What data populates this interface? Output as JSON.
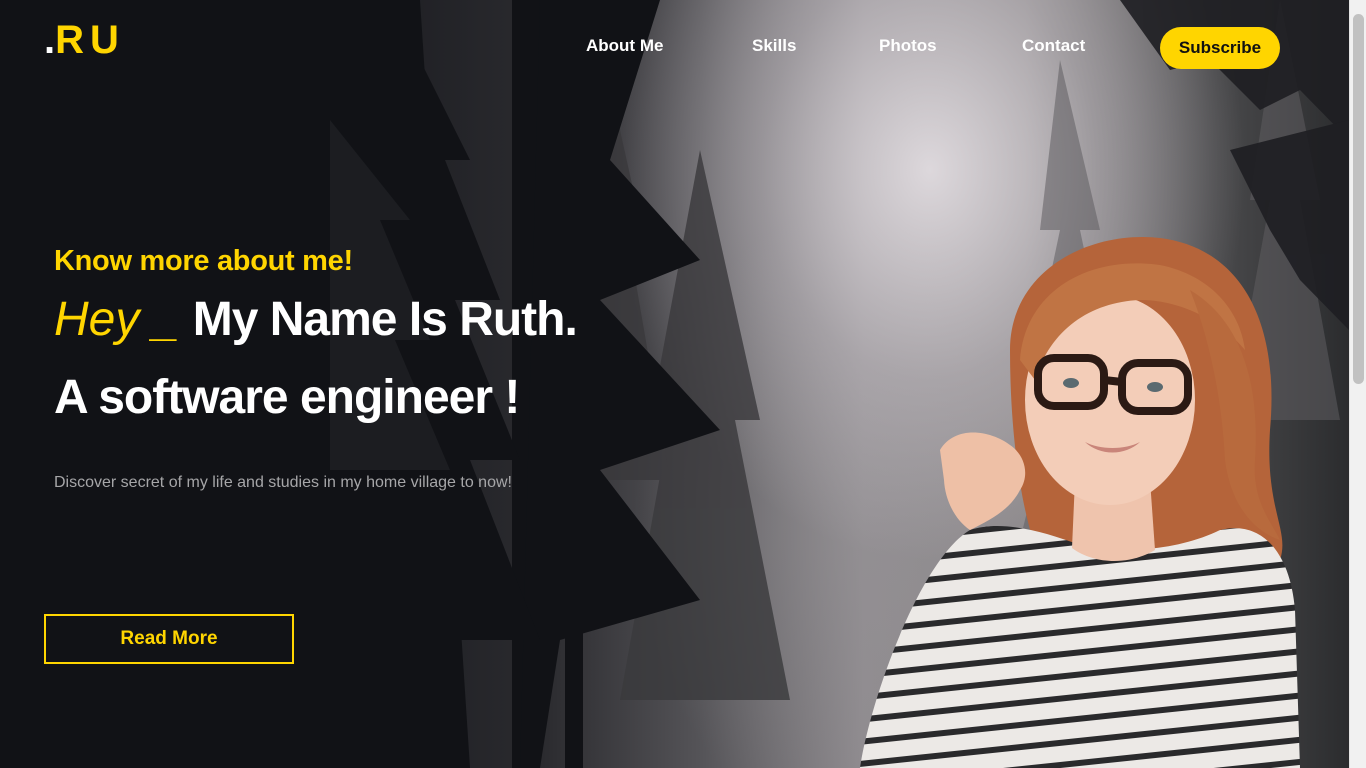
{
  "brand": {
    "logo_dot": ".",
    "logo_text": "RU",
    "accent": "#ffd500"
  },
  "nav": {
    "items": [
      {
        "label": "About Me"
      },
      {
        "label": "Skills"
      },
      {
        "label": "Photos"
      },
      {
        "label": "Contact"
      }
    ],
    "subscribe_label": "Subscribe"
  },
  "hero": {
    "eyebrow": "Know more about me!",
    "hey": "Hey _",
    "name_line": "My Name Is Ruth.",
    "role_line": "A software engineer !",
    "lead": "Discover secret of my life and studies in my home village to now!",
    "cta_label": "Read More"
  },
  "colors": {
    "background_dark": "#15161b",
    "text_white": "#ffffff",
    "text_muted": "#a6a6a8"
  }
}
